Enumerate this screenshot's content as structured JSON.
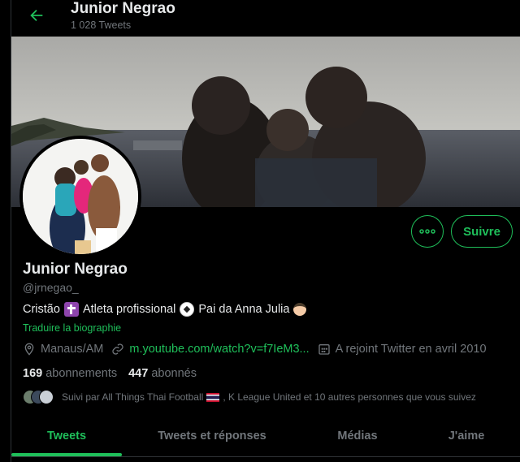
{
  "header": {
    "title": "Junior Negrao",
    "tweet_count": "1 028 Tweets"
  },
  "profile": {
    "name": "Junior Negrao",
    "handle": "@jrnegao_",
    "bio": {
      "part1": "Cristão",
      "part2": "Atleta profissional",
      "part3": "Pai da Anna Julia"
    },
    "translate_label": "Traduire la biographie",
    "location": "Manaus/AM",
    "website": "m.youtube.com/watch?v=f7IeM3...",
    "joined": "A rejoint Twitter en avril 2010",
    "following_count": "169",
    "following_label": "abonnements",
    "followers_count": "447",
    "followers_label": "abonnés",
    "followed_by": {
      "prefix": "Suivi par All Things Thai Football",
      "suffix": ", K League United et 10 autres personnes que vous suivez"
    }
  },
  "actions": {
    "follow_label": "Suivre"
  },
  "tabs": [
    {
      "label": "Tweets",
      "active": true
    },
    {
      "label": "Tweets et réponses",
      "active": false
    },
    {
      "label": "Médias",
      "active": false
    },
    {
      "label": "J'aime",
      "active": false
    }
  ],
  "colors": {
    "accent": "#1fbf5a",
    "background": "#000000",
    "muted": "#71767b"
  }
}
